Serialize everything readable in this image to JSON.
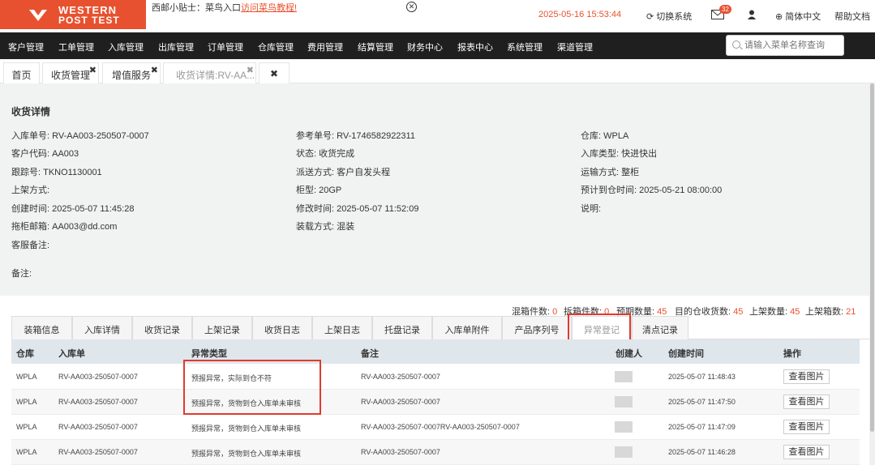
{
  "brand": {
    "line1": "WESTERN",
    "line2": "POST TEST",
    "color": "#e8512f"
  },
  "tip": {
    "label": "西邮小贴士：菜鸟入口",
    "link": "访问菜鸟教程!"
  },
  "header": {
    "datetime": "2025-05-16 15:53:44",
    "switch_label": "切换系统",
    "mail_count": "32",
    "language": "简体中文",
    "help": "帮助文档"
  },
  "nav": {
    "items": [
      "客户管理",
      "工单管理",
      "入库管理",
      "出库管理",
      "订单管理",
      "仓库管理",
      "费用管理",
      "结算管理",
      "财务中心",
      "报表中心",
      "系统管理",
      "渠道管理"
    ],
    "search_placeholder": "请输入菜单名称查询"
  },
  "page_tabs": [
    {
      "label": "首页"
    },
    {
      "label": "收货管理"
    },
    {
      "label": "增值服务"
    },
    {
      "label": "收货详情:RV-AA..."
    }
  ],
  "detail": {
    "title": "收货详情",
    "col1": [
      "入库单号: RV-AA003-250507-0007",
      "客户代码: AA003",
      "跟踪号: TKNO1130001",
      "上架方式:",
      "创建时间: 2025-05-07 11:45:28",
      "拖柜邮箱: AA003@dd.com",
      "客服备注:",
      "备注:"
    ],
    "col2": [
      "参考单号: RV-1746582922311",
      "状态: 收货完成",
      "派送方式: 客户自发头程",
      "柜型: 20GP",
      "修改时间: 2025-05-07 11:52:09",
      "装载方式: 混装"
    ],
    "col3": [
      "仓库: WPLA",
      "入库类型: 快进快出",
      "运输方式: 整柜",
      "预计到仓时间: 2025-05-21 08:00:00",
      "说明:"
    ]
  },
  "summary": [
    {
      "label": "混箱件数:",
      "value": "0"
    },
    {
      "label": "拆箱件数:",
      "value": "0"
    },
    {
      "label": "预期数量:",
      "value": "45"
    },
    {
      "label": "目的仓收货数:",
      "value": "45"
    },
    {
      "label": "上架数量:",
      "value": "45"
    },
    {
      "label": "上架箱数:",
      "value": "21"
    }
  ],
  "sub_tabs": [
    "装箱信息",
    "入库详情",
    "收货记录",
    "上架记录",
    "收货日志",
    "上架日志",
    "托盘记录",
    "入库单附件",
    "产品序列号",
    "异常登记",
    "清点记录"
  ],
  "table": {
    "headers": [
      "仓库",
      "入库单",
      "异常类型",
      "备注",
      "创建人",
      "创建时间",
      "操作"
    ],
    "rows": [
      {
        "warehouse": "WPLA",
        "order": "RV-AA003-250507-0007",
        "type": "预报异常，实际到仓不符",
        "note": "RV-AA003-250507-0007",
        "time": "2025-05-07 11:48:43",
        "action": "查看图片"
      },
      {
        "warehouse": "WPLA",
        "order": "RV-AA003-250507-0007",
        "type": "预报异常，货物到仓入库单未审核",
        "note": "RV-AA003-250507-0007",
        "time": "2025-05-07 11:47:50",
        "action": "查看图片"
      },
      {
        "warehouse": "WPLA",
        "order": "RV-AA003-250507-0007",
        "type": "预报异常，货物到仓入库单未审核",
        "note": "RV-AA003-250507-0007RV-AA003-250507-0007",
        "time": "2025-05-07 11:47:09",
        "action": "查看图片"
      },
      {
        "warehouse": "WPLA",
        "order": "RV-AA003-250507-0007",
        "type": "预报异常，货物到仓入库单未审核",
        "note": "RV-AA003-250507-0007",
        "time": "2025-05-07 11:46:28",
        "action": "查看图片"
      }
    ]
  }
}
